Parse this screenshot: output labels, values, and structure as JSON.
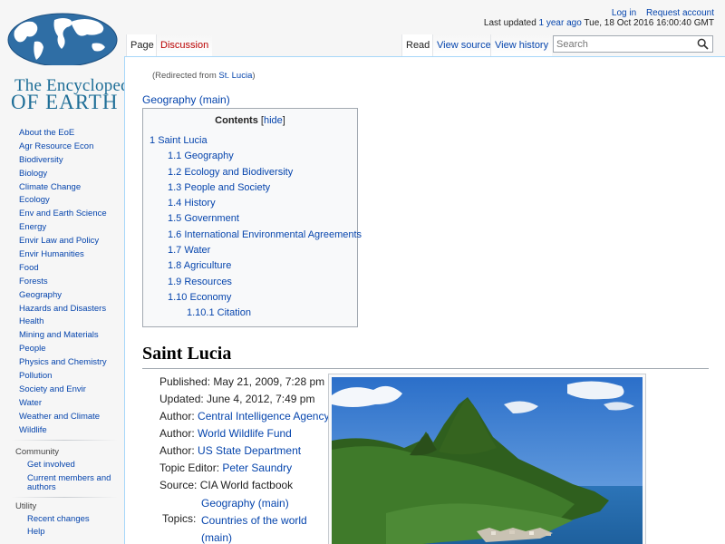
{
  "logo": {
    "line1": "The Encyclopedia",
    "line2": "OF EARTH"
  },
  "sidebar": {
    "main": [
      "About the EoE",
      "Agr Resource Econ",
      "Biodiversity",
      "Biology",
      "Climate Change",
      "Ecology",
      "Env and Earth Science",
      "Energy",
      "Envir Law and Policy",
      "Envir Humanities",
      "Food",
      "Forests",
      "Geography",
      "Hazards and Disasters",
      "Health",
      "Mining and Materials",
      "People",
      "Physics and Chemistry",
      "Pollution",
      "Society and Envir",
      "Water",
      "Weather and Climate",
      "Wildlife"
    ],
    "community_heading": "Community",
    "community": [
      "Get involved",
      "Current members and authors"
    ],
    "utility_heading": "Utility",
    "utility": [
      "Recent changes",
      "Help"
    ]
  },
  "personal": {
    "login": "Log in",
    "request_account": "Request account"
  },
  "last_updated": {
    "prefix": "Last updated ",
    "ago": "1 year ago",
    "date": " Tue, 18 Oct 2016 16:00:40 GMT"
  },
  "tabs": {
    "page": "Page",
    "discussion": "Discussion",
    "read": "Read",
    "view_source": "View source",
    "view_history": "View history"
  },
  "search": {
    "placeholder": "Search",
    "icon": "search-icon"
  },
  "redirect": {
    "prefix": "(Redirected from ",
    "link": "St. Lucia",
    "suffix": ")"
  },
  "geo_main": "Geography (main)",
  "toc": {
    "title": "Contents",
    "hide_open": "[",
    "hide": "hide",
    "hide_close": "]",
    "items": [
      {
        "num": "1",
        "text": "Saint Lucia"
      },
      {
        "num": "1.1",
        "text": "Geography"
      },
      {
        "num": "1.2",
        "text": "Ecology and Biodiversity"
      },
      {
        "num": "1.3",
        "text": "People and Society"
      },
      {
        "num": "1.4",
        "text": "History"
      },
      {
        "num": "1.5",
        "text": "Government"
      },
      {
        "num": "1.6",
        "text": "International Environmental Agreements"
      },
      {
        "num": "1.7",
        "text": "Water"
      },
      {
        "num": "1.8",
        "text": "Agriculture"
      },
      {
        "num": "1.9",
        "text": "Resources"
      },
      {
        "num": "1.10",
        "text": "Economy"
      },
      {
        "num": "1.10.1",
        "text": "Citation"
      }
    ]
  },
  "article": {
    "title": "Saint Lucia",
    "published": "Published: May 21, 2009, 7:28 pm",
    "updated": "Updated: June 4, 2012, 7:49 pm",
    "author_label": "Author: ",
    "authors": [
      "Central Intelligence Agency",
      "World Wildlife Fund",
      "US State Department"
    ],
    "topic_editor_label": "Topic Editor: ",
    "topic_editor": "Peter Saundry",
    "source": "Source: CIA World factbook",
    "topics_label": "Topics:",
    "topics": [
      "Geography (main)",
      "Countries of the world",
      "(main)"
    ]
  }
}
